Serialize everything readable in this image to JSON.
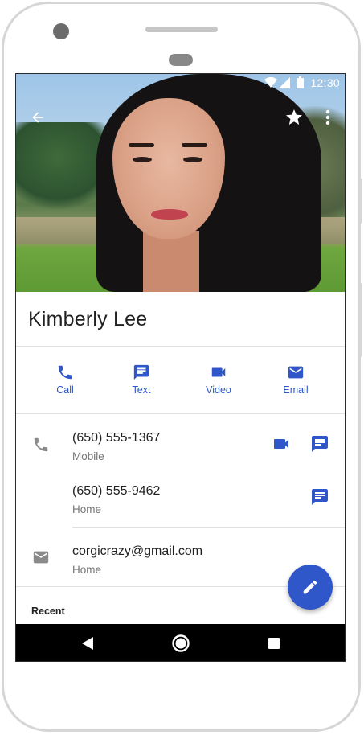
{
  "status_bar": {
    "time": "12:30"
  },
  "contact": {
    "name": "Kimberly Lee"
  },
  "actions": [
    {
      "label": "Call",
      "icon": "phone-icon"
    },
    {
      "label": "Text",
      "icon": "message-icon"
    },
    {
      "label": "Video",
      "icon": "videocam-icon"
    },
    {
      "label": "Email",
      "icon": "email-icon"
    }
  ],
  "phones": [
    {
      "number": "(650) 555-1367",
      "type": "Mobile"
    },
    {
      "number": "(650) 555-9462",
      "type": "Home"
    }
  ],
  "emails": [
    {
      "address": "corgicrazy@gmail.com",
      "type": "Home"
    }
  ],
  "recent": {
    "label": "Recent"
  },
  "colors": {
    "accent": "#2f57c9",
    "icon_gray": "#8a8a8a",
    "nav_bar": "#000000"
  }
}
